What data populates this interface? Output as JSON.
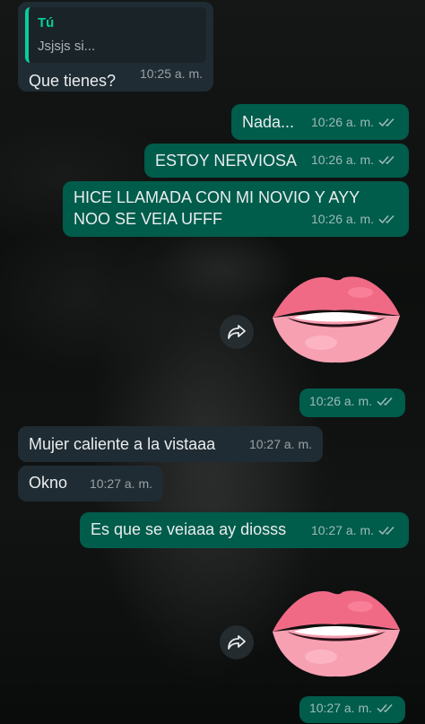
{
  "messages": {
    "m1": {
      "quote_author": "Tú",
      "quote_text": "Jsjsjs si...",
      "text": "Que tienes?",
      "time": "10:25 a. m."
    },
    "m2": {
      "text": "Nada...",
      "time": "10:26 a. m."
    },
    "m3": {
      "text": "ESTOY NERVIOSA",
      "time": "10:26 a. m."
    },
    "m4": {
      "text": "HICE LLAMADA CON MI NOVIO Y AYY NOO SE VEIA UFFF",
      "time": "10:26 a. m."
    },
    "m5": {
      "sticker": "biting-lips-emoji",
      "time": "10:26 a. m."
    },
    "m6": {
      "text": "Mujer caliente a la vistaaa",
      "time": "10:27 a. m."
    },
    "m7": {
      "text": "Okno",
      "time": "10:27 a. m."
    },
    "m8": {
      "text": "Es que se veiaaa ay diosss",
      "time": "10:27 a. m."
    },
    "m9": {
      "sticker": "biting-lips-emoji",
      "time": "10:27 a. m."
    }
  },
  "icons": {
    "read_receipt": "double-check-icon",
    "forward": "forward-arrow-icon"
  },
  "colors": {
    "incoming_bubble": "#202c33",
    "outgoing_bubble": "#005c4b",
    "quote_accent": "#06cf9c"
  }
}
